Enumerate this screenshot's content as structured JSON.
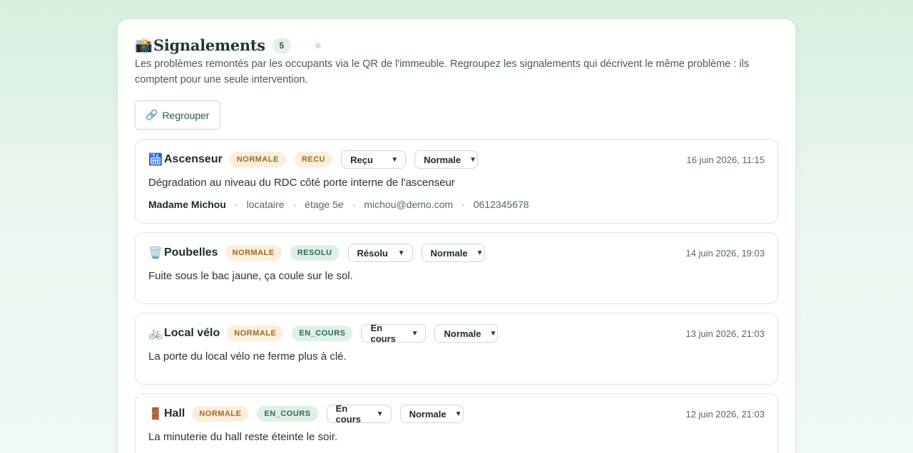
{
  "header": {
    "icon": "📸",
    "title": "Signalements",
    "count": "5",
    "description": "Les problèmes remontés par les occupants via le QR de l'immeuble. Regroupez les signalements qui décrivent le même problème : ils comptent pour une seule intervention.",
    "group_button": "Regrouper",
    "group_icon": "🔗"
  },
  "reports": [
    {
      "icon": "🛗",
      "category": "Ascenseur",
      "priority_badge": "NORMALE",
      "status_badge": "RECU",
      "status_select": "Reçu",
      "priority_select": "Normale",
      "date": "16 juin 2026, 11:15",
      "message": "Dégradation au niveau du RDC côté porte interne de l'ascenseur",
      "reporter": {
        "name": "Madame Michou",
        "role": "locataire",
        "floor": "étage 5e",
        "email": "michou@demo.com",
        "phone": "0612345678"
      }
    },
    {
      "icon": "🗑️",
      "category": "Poubelles",
      "priority_badge": "NORMALE",
      "status_badge": "RESOLU",
      "status_select": "Résolu",
      "priority_select": "Normale",
      "date": "14 juin 2026, 19:03",
      "message": "Fuite sous le bac jaune, ça coule sur le sol."
    },
    {
      "icon": "🚲",
      "category": "Local vélo",
      "priority_badge": "NORMALE",
      "status_badge": "EN_COURS",
      "status_select": "En cours",
      "priority_select": "Normale",
      "date": "13 juin 2026, 21:03",
      "message": "La porte du local vélo ne ferme plus à clé."
    },
    {
      "icon": "🚪",
      "category": "Hall",
      "priority_badge": "NORMALE",
      "status_badge": "EN_COURS",
      "status_select": "En cours",
      "priority_select": "Normale",
      "date": "12 juin 2026, 21:03",
      "message": "La minuterie du hall reste éteinte le soir."
    }
  ],
  "colors": {
    "accent": "#2b5a44",
    "badge_orange_bg": "#fbefdc",
    "badge_green_bg": "#dff0e6"
  }
}
